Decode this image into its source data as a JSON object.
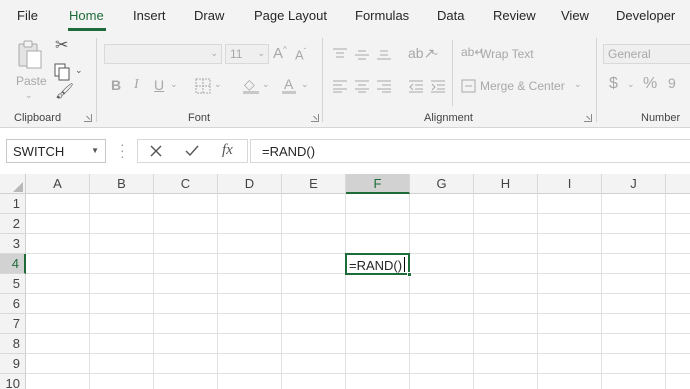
{
  "tabs": [
    {
      "label": "File"
    },
    {
      "label": "Home"
    },
    {
      "label": "Insert"
    },
    {
      "label": "Draw"
    },
    {
      "label": "Page Layout"
    },
    {
      "label": "Formulas"
    },
    {
      "label": "Data"
    },
    {
      "label": "Review"
    },
    {
      "label": "View"
    },
    {
      "label": "Developer"
    }
  ],
  "active_tab": "Home",
  "ribbon": {
    "clipboard": {
      "label": "Clipboard",
      "paste_label": "Paste"
    },
    "font": {
      "label": "Font",
      "size_value": "11",
      "bold": "B",
      "italic": "I",
      "underline": "U"
    },
    "alignment": {
      "label": "Alignment",
      "wrap_text": "Wrap Text",
      "merge_center": "Merge & Center"
    },
    "number": {
      "label": "Number",
      "format_value": "General",
      "currency_symbol": "$",
      "percent_symbol": "%"
    }
  },
  "formula_bar": {
    "name_box": "SWITCH",
    "cancel_icon": "close-icon",
    "enter_icon": "check-icon",
    "fx_label": "fx",
    "formula": "=RAND()"
  },
  "grid": {
    "columns": [
      "A",
      "B",
      "C",
      "D",
      "E",
      "F",
      "G",
      "H",
      "I",
      "J"
    ],
    "rows": [
      "1",
      "2",
      "3",
      "4",
      "5",
      "6",
      "7",
      "8",
      "9",
      "10"
    ],
    "selected_column": "F",
    "selected_row": "4",
    "active_cell": {
      "ref": "F4",
      "value": "=RAND()"
    }
  },
  "colors": {
    "accent": "#1e6b3a",
    "ribbon_bg": "#f3f3f3",
    "disabled": "#a8a8a8"
  }
}
